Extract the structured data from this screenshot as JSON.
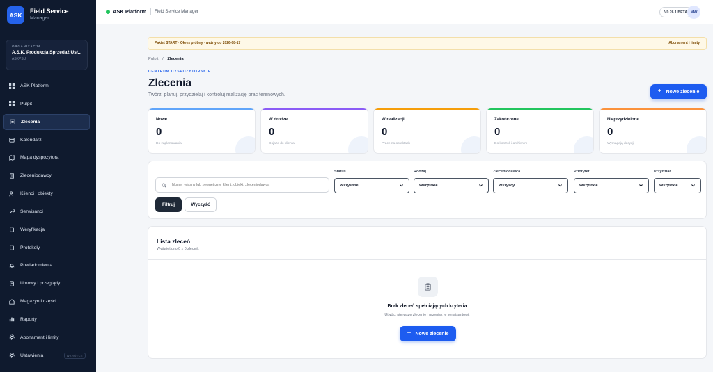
{
  "brand": {
    "logo": "ASK",
    "title": "Field Service",
    "subtitle": "Manager"
  },
  "org": {
    "label": "ORGANIZACJA",
    "name": "A.S.K. Produkcja Sprzedaż Usł...",
    "code": "ASKPSU"
  },
  "sidebar": {
    "items": [
      {
        "label": "ASK Platform",
        "icon": "grid-icon"
      },
      {
        "label": "Pulpit",
        "icon": "grid-icon"
      },
      {
        "label": "Zlecenia",
        "icon": "clipboard-icon",
        "active": true
      },
      {
        "label": "Kalendarz",
        "icon": "calendar-icon"
      },
      {
        "label": "Mapa dyspozytora",
        "icon": "map-icon"
      },
      {
        "label": "Zleceniodawcy",
        "icon": "building-icon"
      },
      {
        "label": "Klienci i obiekty",
        "icon": "users-icon"
      },
      {
        "label": "Serwisanci",
        "icon": "wrench-icon"
      },
      {
        "label": "Weryfikacja",
        "icon": "document-icon"
      },
      {
        "label": "Protokoły",
        "icon": "document-icon"
      },
      {
        "label": "Powiadomienia",
        "icon": "bell-icon"
      },
      {
        "label": "Umowy i przeglądy",
        "icon": "contract-icon"
      },
      {
        "label": "Magazyn i części",
        "icon": "warehouse-icon"
      },
      {
        "label": "Raporty",
        "icon": "bar-chart-icon"
      },
      {
        "label": "Abonament i limity",
        "icon": "gear-icon"
      },
      {
        "label": "Ustawienia",
        "icon": "gear-icon",
        "badge": "WKRÓTCE"
      }
    ]
  },
  "topbar": {
    "platform": "ASK Platform",
    "app": "Field Service Manager",
    "version": "V0.26.1 BETA",
    "avatar": "MW"
  },
  "banner": {
    "text": "Pakiet START · Okres próbny · ważny do 2026-08-17",
    "link": "Abonament i limity"
  },
  "breadcrumb": {
    "root": "Pulpit",
    "sep": "/",
    "current": "Zlecenia"
  },
  "header": {
    "eyebrow": "CENTRUM DYSPOZYTORSKIE",
    "title": "Zlecenia",
    "description": "Twórz, planuj, przydzielaj i kontroluj realizację prac terenowych.",
    "new_button": "Nowe zlecenie"
  },
  "stats": [
    {
      "label": "Nowe",
      "value": "0",
      "sub": "Do zaplanowania",
      "color": "#60a5fa"
    },
    {
      "label": "W drodze",
      "value": "0",
      "sub": "Dojazd do klienta",
      "color": "#8b5cf6"
    },
    {
      "label": "W realizacji",
      "value": "0",
      "sub": "Prace na obiektach",
      "color": "#f59e0b"
    },
    {
      "label": "Zakończone",
      "value": "0",
      "sub": "Do kontroli i archiwum",
      "color": "#22c55e"
    },
    {
      "label": "Nieprzydzielone",
      "value": "0",
      "sub": "Wymagają decyzji",
      "color": "#fb923c"
    }
  ],
  "filters": {
    "search_placeholder": "Numer własny lub zewnętrzny, klient, obiekt, zleceniodawca",
    "fields": [
      {
        "label": "Status",
        "value": "Wszystkie"
      },
      {
        "label": "Rodzaj",
        "value": "Wszystkie"
      },
      {
        "label": "Zleceniodawca",
        "value": "Wszyscy"
      },
      {
        "label": "Priorytet",
        "value": "Wszystkie"
      },
      {
        "label": "Przydział",
        "value": "Wszystkie"
      }
    ],
    "filter_button": "Filtruj",
    "clear_button": "Wyczyść"
  },
  "list": {
    "title": "Lista zleceń",
    "count": "Wyświetlono 0 z 0 zleceń.",
    "empty_title": "Brak zleceń spełniających kryteria",
    "empty_sub": "Utwórz pierwsze zlecenie i przypisz je serwisantowi.",
    "empty_button": "Nowe zlecenie"
  }
}
